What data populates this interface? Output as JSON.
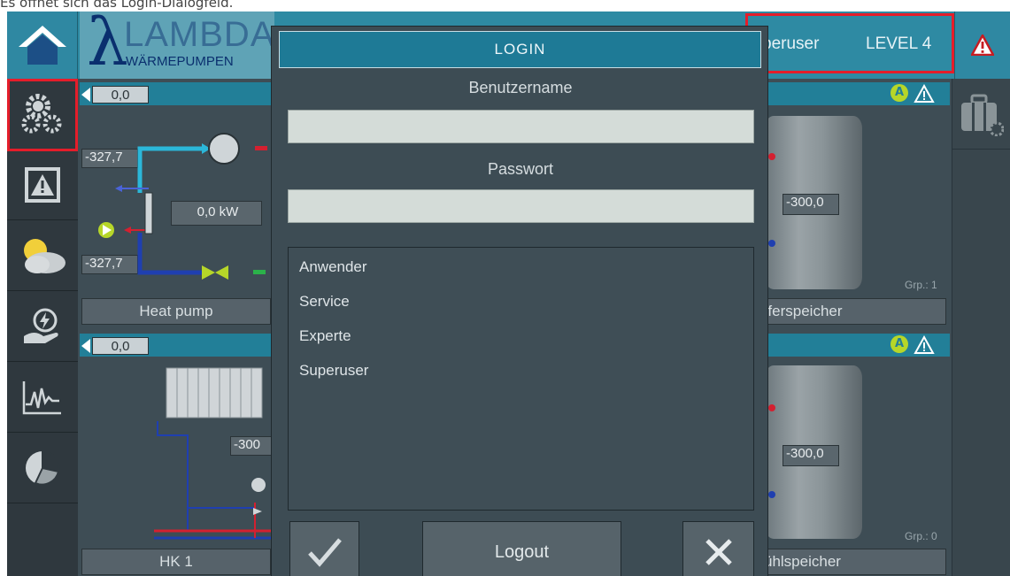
{
  "caption": "Es öffnet sich das Login-Dialogfeld.",
  "header": {
    "logo_lambda": "λ",
    "logo_text": "LAMBDA",
    "logo_sub": "WÄRMEPUMPEN",
    "user": "peruser",
    "level": "LEVEL 4"
  },
  "sidebar": {
    "items": [
      "settings",
      "alarm-log",
      "weather",
      "energy",
      "trend",
      "statistics"
    ]
  },
  "panels": {
    "heatpump": {
      "bar_value": "0,0",
      "temp_top": "-327,7",
      "temp_bottom": "-327,7",
      "power": "0,0 kW",
      "label": "Heat pump"
    },
    "buffer": {
      "temp": "-300,0",
      "grp": "Grp.: 1",
      "label": "fferspeicher"
    },
    "hk1": {
      "bar_value": "0,0",
      "temp": "-300",
      "label": "HK 1"
    },
    "cooling": {
      "temp": "-300,0",
      "grp": "Grp.: 0",
      "label": "ühlspeicher"
    }
  },
  "dialog": {
    "title": "LOGIN",
    "username_label": "Benutzername",
    "username_value": "",
    "password_label": "Passwort",
    "password_value": "",
    "users": [
      "Anwender",
      "Service",
      "Experte",
      "Superuser"
    ],
    "confirm_icon": "checkmark-icon",
    "logout_label": "Logout",
    "cancel_icon": "close-icon"
  },
  "colors": {
    "highlight": "#e51d2a",
    "header_teal": "#2e8aa3",
    "status_green": "#b6d629"
  }
}
